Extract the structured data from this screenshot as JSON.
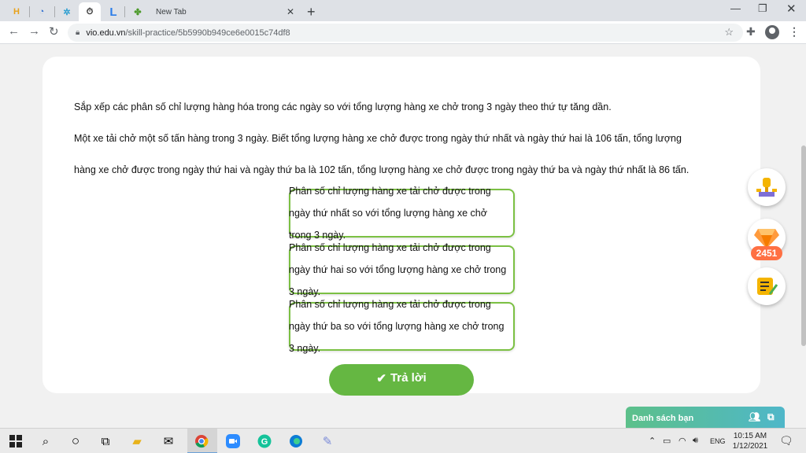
{
  "browser": {
    "tabs": [
      {
        "icon": "hoc247-icon",
        "glyph": "H",
        "color": "#e8a11a"
      },
      {
        "icon": "olm-icon",
        "glyph": "◔",
        "color": "#2f6fd1"
      },
      {
        "icon": "dots-icon",
        "glyph": "✲",
        "color": "#2f9fd1"
      },
      {
        "icon": "vio-icon",
        "glyph": "⏱",
        "color": "#333333"
      },
      {
        "icon": "l-icon",
        "glyph": "L",
        "color": "#2b7de9"
      },
      {
        "icon": "tree-icon",
        "glyph": "✤",
        "color": "#4c9a2a"
      }
    ],
    "new_tab_title": "New Tab",
    "url_host": "vio.edu.vn",
    "url_path": "/skill-practice/5b5990b949ce6e0015c74df8"
  },
  "question": {
    "line1": "Sắp xếp các phân số chỉ lượng hàng hóa trong các ngày so với tổng lượng hàng xe chở trong 3 ngày theo thứ tự tăng dần.",
    "line2": "Một xe tải chở một số tấn hàng trong 3 ngày. Biết tổng lượng hàng xe chở được trong ngày thứ nhất và ngày thứ hai là 106 tấn, tổng lượng",
    "line3": "hàng xe chở được trong ngày thứ hai và ngày thứ ba là 102 tấn, tổng lượng hàng xe chở được trong ngày thứ ba và ngày thứ nhất là 86 tấn."
  },
  "sort_items": [
    {
      "lines": [
        "Phân số chỉ lượng hàng xe tải chở được trong",
        "ngày thứ nhất so với tổng lượng hàng xe chở",
        "trong 3 ngày."
      ]
    },
    {
      "lines": [
        "Phân số chỉ lượng hàng xe tải chở được trong",
        "ngày thứ hai so với tổng lượng hàng xe chở trong",
        "3 ngày."
      ]
    },
    {
      "lines": [
        "Phân số chỉ lượng hàng xe tải chở được trong",
        "ngày thứ ba so với tổng lượng hàng xe chở trong",
        "3 ngày."
      ]
    }
  ],
  "answer_button": {
    "icon": "✔",
    "label": "Trả lời"
  },
  "sidebar": {
    "gem_count": "2451"
  },
  "friends_panel": {
    "label": "Danh sách bạn"
  },
  "taskbar": {
    "language": "ENG",
    "time": "10:15 AM",
    "date": "1/12/2021"
  }
}
